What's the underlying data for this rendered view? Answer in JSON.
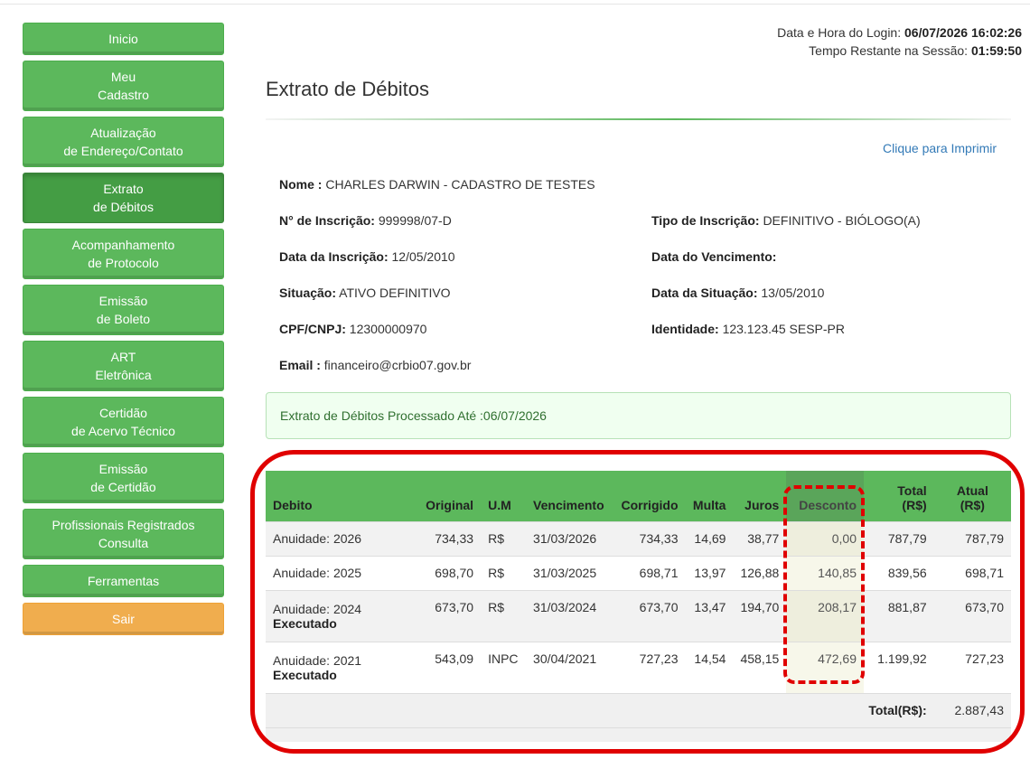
{
  "sidebar": {
    "items": [
      {
        "label": "Inicio"
      },
      {
        "label": "Meu\nCadastro"
      },
      {
        "label": "Atualização\nde Endereço/Contato"
      },
      {
        "label": "Extrato\nde Débitos"
      },
      {
        "label": "Acompanhamento\nde Protocolo"
      },
      {
        "label": "Emissão\nde Boleto"
      },
      {
        "label": "ART\nEletrônica"
      },
      {
        "label": "Certidão\nde Acervo Técnico"
      },
      {
        "label": "Emissão\nde Certidão"
      },
      {
        "label": "Profissionais Registrados\nConsulta"
      },
      {
        "label": "Ferramentas"
      },
      {
        "label": "Sair"
      }
    ]
  },
  "session": {
    "login_label": "Data e Hora do Login:",
    "login_value": "06/07/2026 16:02:26",
    "remaining_label": "Tempo Restante na Sessão:",
    "remaining_value": "01:59:50"
  },
  "page": {
    "title": "Extrato de Débitos",
    "print_link": "Clique para Imprimir"
  },
  "profile": {
    "nome_label": "Nome :",
    "nome": "CHARLES DARWIN - CADASTRO DE TESTES",
    "inscricao_label": "N° de Inscrição:",
    "inscricao": "999998/07-D",
    "tipo_label": "Tipo de Inscrição:",
    "tipo": "DEFINITIVO - BIÓLOGO(A)",
    "data_inscricao_label": "Data da Inscrição:",
    "data_inscricao": "12/05/2010",
    "vencimento_label": "Data do Vencimento:",
    "vencimento": "",
    "situacao_label": "Situação:",
    "situacao": "ATIVO DEFINITIVO",
    "data_situacao_label": "Data da Situação:",
    "data_situacao": "13/05/2010",
    "cpf_label": "CPF/CNPJ:",
    "cpf": "12300000970",
    "identidade_label": "Identidade:",
    "identidade": "123.123.45 SESP-PR",
    "email_label": "Email :",
    "email": "financeiro@crbio07.gov.br"
  },
  "alert": {
    "text": "Extrato de Débitos Processado Até :06/07/2026"
  },
  "table": {
    "headers": {
      "debito": "Debito",
      "original": "Original",
      "um": "U.M",
      "vencimento": "Vencimento",
      "corrigido": "Corrigido",
      "multa": "Multa",
      "juros": "Juros",
      "desconto": "Desconto",
      "total": "Total (R$)",
      "atual_1": "Atual",
      "atual_2": "(R$)"
    },
    "rows": [
      {
        "debito": "Anuidade: 2026",
        "status": "",
        "original": "734,33",
        "um": "R$",
        "vencimento": "31/03/2026",
        "corrigido": "734,33",
        "multa": "14,69",
        "juros": "38,77",
        "desconto": "0,00",
        "total": "787,79",
        "atual": "787,79"
      },
      {
        "debito": "Anuidade: 2025",
        "status": "",
        "original": "698,70",
        "um": "R$",
        "vencimento": "31/03/2025",
        "corrigido": "698,71",
        "multa": "13,97",
        "juros": "126,88",
        "desconto": "140,85",
        "total": "839,56",
        "atual": "698,71"
      },
      {
        "debito": "Anuidade: 2024",
        "status": "Executado",
        "original": "673,70",
        "um": "R$",
        "vencimento": "31/03/2024",
        "corrigido": "673,70",
        "multa": "13,47",
        "juros": "194,70",
        "desconto": "208,17",
        "total": "881,87",
        "atual": "673,70"
      },
      {
        "debito": "Anuidade: 2021",
        "status": "Executado",
        "original": "543,09",
        "um": "INPC",
        "vencimento": "30/04/2021",
        "corrigido": "727,23",
        "multa": "14,54",
        "juros": "458,15",
        "desconto": "472,69",
        "total": "1.199,92",
        "atual": "727,23"
      }
    ],
    "total_label": "Total(R$):",
    "total_value": "2.887,43"
  },
  "colors": {
    "nav_green": "#5cb85c",
    "nav_active": "#449d44",
    "nav_warning": "#f0ad4e",
    "link_blue": "#337ab7",
    "annotation_red": "#e00000"
  }
}
